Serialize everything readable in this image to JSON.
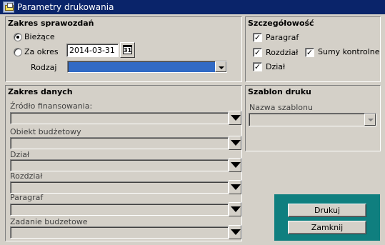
{
  "window": {
    "title": "Parametry drukowania"
  },
  "zakres_sprawozdan": {
    "title": "Zakres sprawozdań",
    "biezace_label": "Bieżące",
    "za_okres_label": "Za okres",
    "date_value": "2014-03-31",
    "calendar_glyph": "31",
    "rodzaj_label": "Rodzaj",
    "rodzaj_value": ""
  },
  "szczegolowosc": {
    "title": "Szczegółowość",
    "paragraf_label": "Paragraf",
    "rozdzial_label": "Rozdział",
    "dzial_label": "Dział",
    "sumy_label": "Sumy kontrolne",
    "check_mark": "✓"
  },
  "zakres_danych": {
    "title": "Zakres danych",
    "fields": [
      {
        "label": "Źródło finansowania:",
        "value": ""
      },
      {
        "label": "Obiekt budżetowy",
        "value": ""
      },
      {
        "label": "Dział",
        "value": ""
      },
      {
        "label": "Rozdział",
        "value": ""
      },
      {
        "label": "Paragraf",
        "value": ""
      },
      {
        "label": "Zadanie budzetowe",
        "value": ""
      }
    ]
  },
  "szablon_druku": {
    "title": "Szablon druku",
    "nazwa_label": "Nazwa szablonu",
    "nazwa_value": ""
  },
  "actions": {
    "drukuj_label": "Drukuj",
    "zamknij_label": "Zamknij"
  },
  "colors": {
    "title_bar": "#0a246a",
    "face": "#d4d0c8",
    "selection": "#316ac5",
    "teal_panel": "#0f7f7f"
  }
}
